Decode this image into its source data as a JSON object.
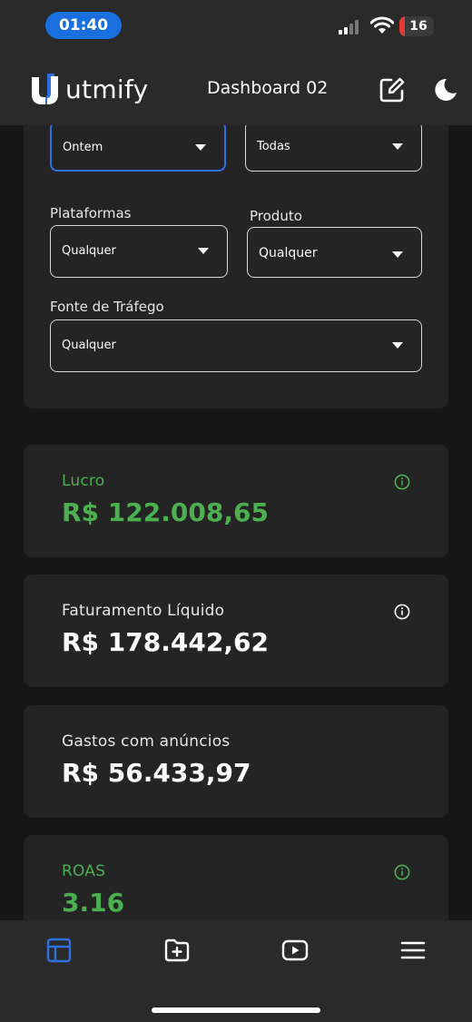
{
  "status_bar": {
    "time": "01:40",
    "battery": "16"
  },
  "header": {
    "brand": "utmify",
    "title": "Dashboard 02"
  },
  "filters": {
    "period": {
      "value": "Ontem"
    },
    "account": {
      "value": "Todas"
    },
    "plataformas": {
      "label": "Plataformas",
      "value": "Qualquer"
    },
    "produto": {
      "label": "Produto",
      "value": "Qualquer"
    },
    "fonte": {
      "label": "Fonte de Tráfego",
      "value": "Qualquer"
    }
  },
  "metrics": [
    {
      "label": "Lucro",
      "value": "R$ 122.008,65",
      "highlight": true,
      "info": true
    },
    {
      "label": "Faturamento Líquido",
      "value": "R$ 178.442,62",
      "highlight": false,
      "info": true
    },
    {
      "label": "Gastos com anúncios",
      "value": "R$ 56.433,97",
      "highlight": false,
      "info": false
    },
    {
      "label": "ROAS",
      "value": "3.16",
      "highlight": true,
      "info": true
    }
  ],
  "nav": [
    "dashboard-icon",
    "folder-add-icon",
    "video-icon",
    "menu-icon"
  ],
  "colors": {
    "accent": "#2f6fe0",
    "positive": "#4caf50",
    "card": "#242424",
    "background": "#161616"
  }
}
